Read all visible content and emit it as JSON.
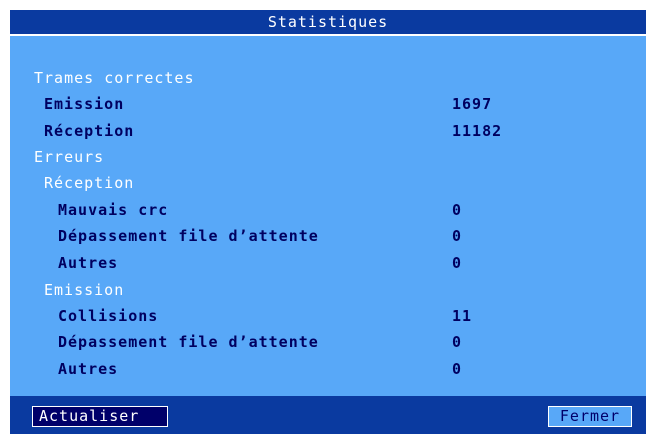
{
  "window": {
    "title": "Statistiques"
  },
  "stats": {
    "trames_correctes_label": "Trames correctes",
    "emission_label": "Emission",
    "emission_value": "1697",
    "reception_label": "Réception",
    "reception_value": "11182",
    "erreurs_label": "Erreurs",
    "err_reception_label": "Réception",
    "mauvais_crc_label": "Mauvais crc",
    "mauvais_crc_value": "0",
    "rx_overflow_label": "Dépassement file d’attente",
    "rx_overflow_value": "0",
    "rx_autres_label": "Autres",
    "rx_autres_value": "0",
    "err_emission_label": "Emission",
    "collisions_label": "Collisions",
    "collisions_value": "11",
    "tx_overflow_label": "Dépassement file d’attente",
    "tx_overflow_value": "0",
    "tx_autres_label": "Autres",
    "tx_autres_value": "0"
  },
  "buttons": {
    "refresh_label": "Actualiser",
    "close_label": "Fermer"
  },
  "colors": {
    "background": "#58a8f8",
    "titlebar": "#0a3aa0",
    "text_dark": "#000060",
    "text_light": "#ffffff"
  }
}
